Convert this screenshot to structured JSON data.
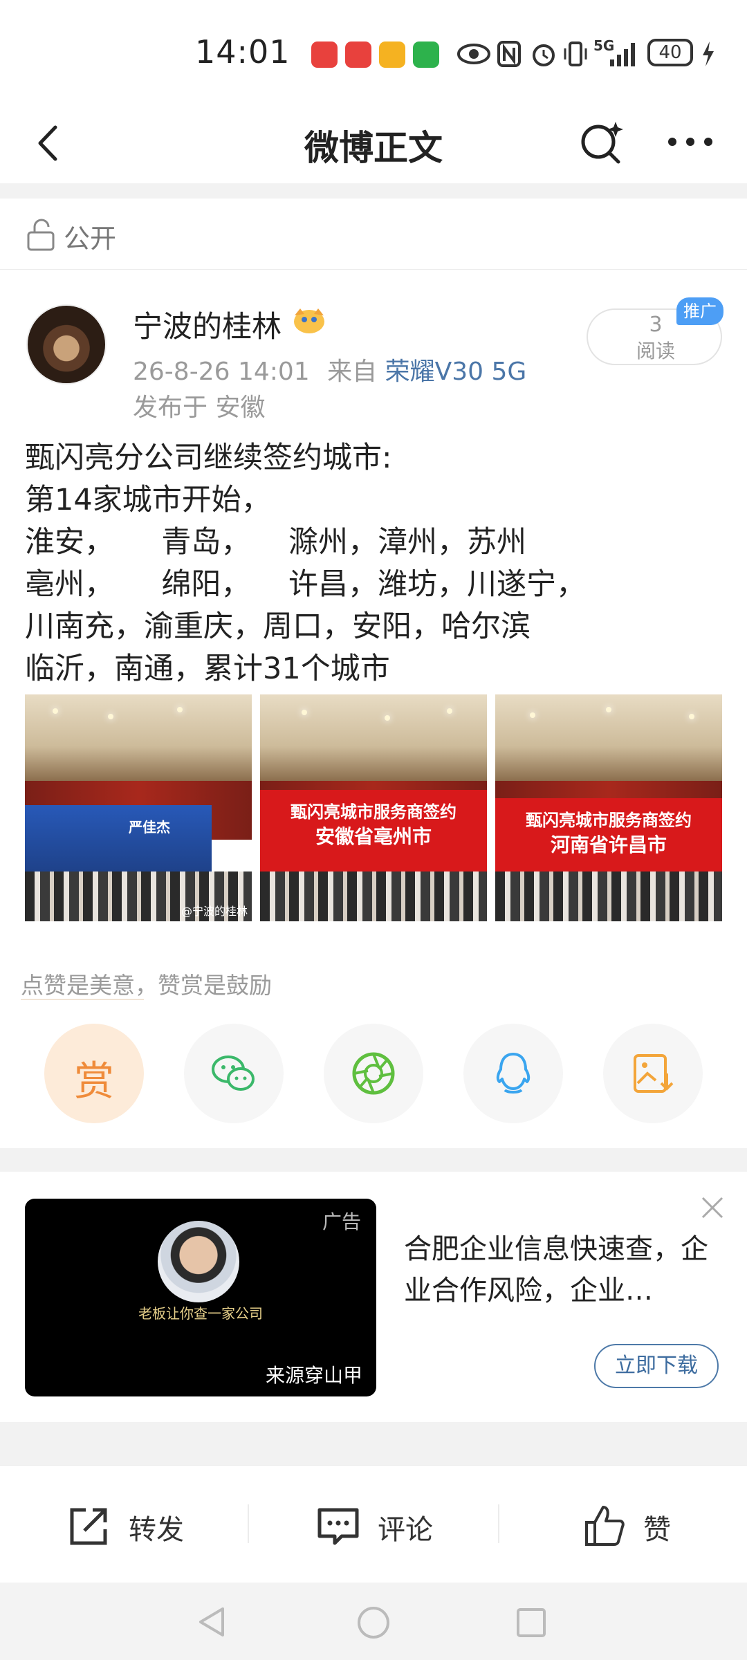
{
  "status_bar": {
    "time": "14:01",
    "network": "5G",
    "battery": "40"
  },
  "header": {
    "title": "微博正文"
  },
  "privacy": {
    "label": "公开"
  },
  "post": {
    "author": "宁波的桂林",
    "time": "26-8-26 14:01",
    "source_prefix": "来自",
    "device": "荣耀V30 5G",
    "location": "发布于 安徽",
    "read_count": "3",
    "read_label": "阅读",
    "promo_tag": "推广",
    "text_lines": [
      "甄闪亮分公司继续签约城市:",
      "第14家城市开始，",
      "淮安，     青岛，    滁州，漳州，苏州",
      "亳州，     绵阳，    许昌，潍坊，川遂宁，",
      "川南充，渝重庆，周口，安阳，哈尔滨",
      "临沂，南通，累计31个城市"
    ],
    "photos": [
      {
        "screen_title": "严佳杰",
        "screen_sub": "",
        "watermark": "@宁波的桂林"
      },
      {
        "screen_title": "甄闪亮城市服务商签约",
        "screen_sub": "安徽省亳州市",
        "watermark": ""
      },
      {
        "screen_title": "甄闪亮城市服务商签约",
        "screen_sub": "河南省许昌市",
        "watermark": ""
      }
    ]
  },
  "reward": {
    "encourage_text": "点赞是美意，赞赏是鼓励",
    "reward_label": "赏",
    "share_targets": [
      "wechat-icon",
      "moments-icon",
      "qq-icon",
      "save-image-icon"
    ]
  },
  "ad": {
    "tag": "广告",
    "caption": "老板让你查一家公司",
    "source": "来源穿山甲",
    "headline": "合肥企业信息快速查，企业合作风险，企业…",
    "download_label": "立即下载"
  },
  "actions": {
    "repost": "转发",
    "comment": "评论",
    "like": "赞"
  },
  "colors": {
    "link_blue": "#4b76a8",
    "reward_orange": "#ef8b3a",
    "promo_blue": "#4d9ef5",
    "wechat_green": "#3bb86a",
    "qq_blue": "#3aa5ef",
    "save_orange": "#f3a53a"
  }
}
